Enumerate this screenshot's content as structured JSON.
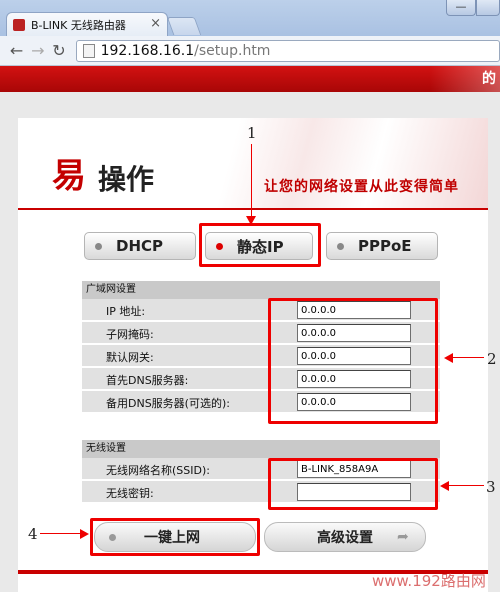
{
  "browser": {
    "tab_title": "B-LINK 无线路由器",
    "tab_close": "×",
    "window_btn": "—",
    "url_host": "192.168.16.1",
    "url_path": "/setup.htm"
  },
  "page": {
    "banner_text": "的",
    "logo_main": "易",
    "logo_rest": "操作",
    "slogan": "让您的网络设置从此变得简单",
    "modes": [
      "DHCP",
      "静态IP",
      "PPPoE"
    ],
    "selected_mode": "静态IP",
    "wan": {
      "title": "广域网设置",
      "fields": [
        {
          "label": "IP 地址:",
          "value": "0.0.0.0"
        },
        {
          "label": "子网掩码:",
          "value": "0.0.0.0"
        },
        {
          "label": "默认网关:",
          "value": "0.0.0.0"
        },
        {
          "label": "首先DNS服务器:",
          "value": "0.0.0.0"
        },
        {
          "label": "备用DNS服务器(可选的):",
          "value": "0.0.0.0"
        }
      ]
    },
    "wlan": {
      "title": "无线设置",
      "fields": [
        {
          "label": "无线网络名称(SSID):",
          "value": "B-LINK_858A9A"
        },
        {
          "label": "无线密钥:",
          "value": ""
        }
      ]
    },
    "onekey_label": "一键上网",
    "advanced_label": "高级设置",
    "advanced_arrow": "➦",
    "watermark": "www.192路由网"
  },
  "annotations": [
    "1",
    "2",
    "3",
    "4"
  ],
  "colors": {
    "accent_red": "#c90000",
    "annotation_red": "#ee0000"
  }
}
